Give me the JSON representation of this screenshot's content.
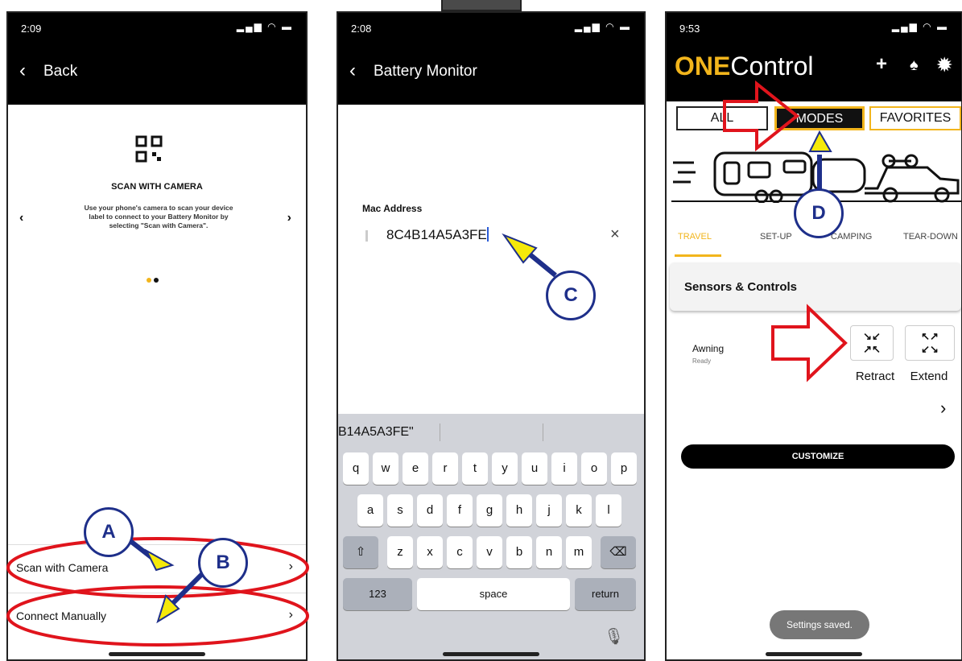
{
  "phones": {
    "scan": {
      "time": "2:09",
      "nav_title": "Back",
      "carousel_title": "SCAN WITH CAMERA",
      "carousel_text": "Use your phone's camera to scan your device label to connect to your Battery Monitor by selecting \"Scan with Camera\".",
      "option_scan": "Scan with Camera",
      "option_manual": "Connect Manually"
    },
    "manual": {
      "time": "2:08",
      "nav_title": "Battery Monitor",
      "field_label": "Mac Address",
      "field_value": "8C4B14A5A3FE",
      "suggestion": "B14A5A3FE\"",
      "keyboard": {
        "row1": [
          "q",
          "w",
          "e",
          "r",
          "t",
          "y",
          "u",
          "i",
          "o",
          "p"
        ],
        "row2": [
          "a",
          "s",
          "d",
          "f",
          "g",
          "h",
          "j",
          "k",
          "l"
        ],
        "row3": [
          "z",
          "x",
          "c",
          "v",
          "b",
          "n",
          "m"
        ],
        "numbers_key": "123",
        "space_key": "space",
        "return_key": "return"
      }
    },
    "onecontrol": {
      "time": "9:53",
      "logo_one": "ONE",
      "logo_control": "Control",
      "segments": [
        "ALL",
        "MODES",
        "FAVORITES"
      ],
      "tabs": [
        "TRAVEL",
        "SET-UP",
        "CAMPING",
        "TEAR-DOWN"
      ],
      "section_title": "Sensors & Controls",
      "device_name": "Awning",
      "device_state": "Ready",
      "retract_label": "Retract",
      "extend_label": "Extend",
      "customize_label": "CUSTOMIZE",
      "toast": "Settings saved."
    }
  },
  "callouts": [
    "A",
    "B",
    "C",
    "D"
  ],
  "colors": {
    "accent": "#f2b51c",
    "callout": "#1e2f8a",
    "highlight": "#e0141c",
    "pointer": "#f5e90a"
  }
}
